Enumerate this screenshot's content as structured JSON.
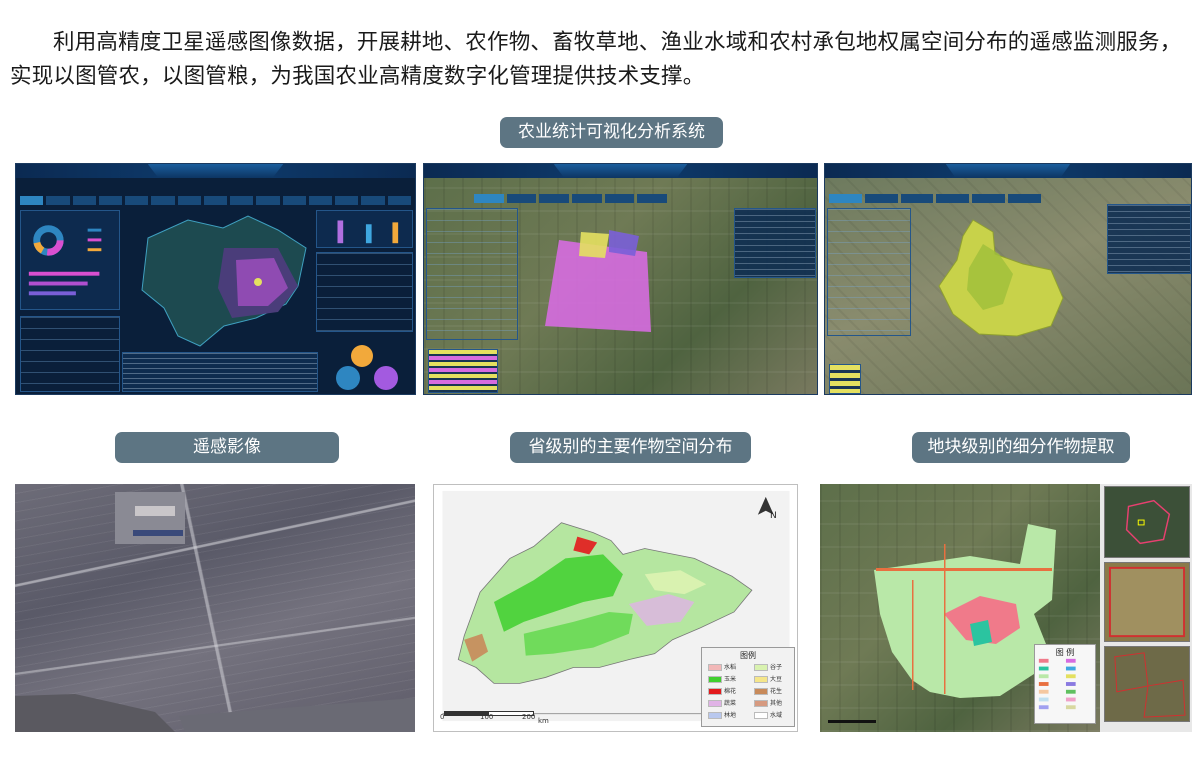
{
  "intro": {
    "text": "利用高精度卫星遥感图像数据，开展耕地、农作物、畜牧草地、渔业水域和农村承包地权属空间分布的遥感监测服务，实现以图管农，以图管粮，为我国农业高精度数字化管理提供技术支撑。"
  },
  "labels": {
    "system": "农业统计可视化分析系统",
    "remote": "遥感影像",
    "province": "省级别的主要作物空间分布",
    "plot": "地块级别的细分作物提取"
  },
  "map": {
    "north": "N",
    "scale_ticks": [
      "0",
      "100",
      "200"
    ],
    "scale_unit": "km",
    "legend_title": "图例",
    "legend_items": [
      {
        "label": "水稻",
        "color": "#f2b8b8"
      },
      {
        "label": "谷子",
        "color": "#d9f2b0"
      },
      {
        "label": "玉米",
        "color": "#3fcf2e"
      },
      {
        "label": "大豆",
        "color": "#f5e68a"
      },
      {
        "label": "棉花",
        "color": "#e31a1c"
      },
      {
        "label": "花生",
        "color": "#c88a5a"
      },
      {
        "label": "蔬菜",
        "color": "#e0b3e6"
      },
      {
        "label": "其他",
        "color": "#d69a80"
      },
      {
        "label": "林地",
        "color": "#b9c8ee"
      },
      {
        "label": "水域",
        "color": "#ffffff"
      }
    ]
  },
  "plot_map": {
    "legend_title": "图 例"
  },
  "colors": {
    "pill_bg": "#5d7583",
    "dash_bg": "#0a1f3a",
    "crop_magenta": "#d66be0",
    "crop_green": "#b9e8a8"
  }
}
